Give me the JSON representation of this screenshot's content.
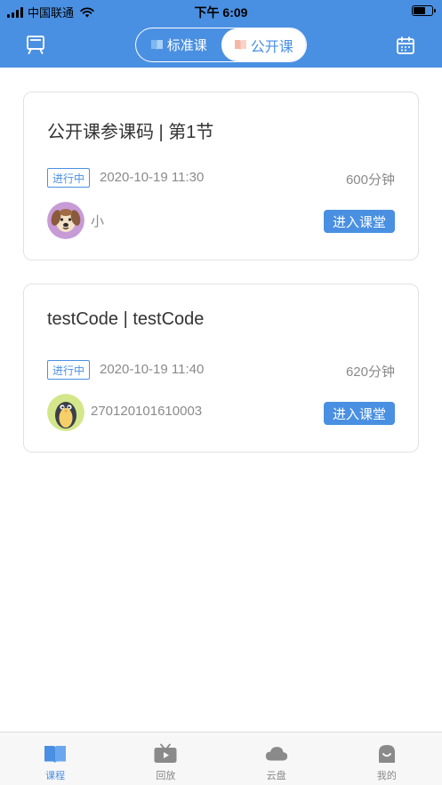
{
  "status_bar": {
    "carrier": "中国联通",
    "time": "下午 6:09"
  },
  "nav": {
    "segments": [
      {
        "label": "标准课",
        "active": false
      },
      {
        "label": "公开课",
        "active": true
      }
    ]
  },
  "courses": [
    {
      "title": "公开课参课码 | 第1节",
      "status": "进行中",
      "datetime": "2020-10-19 11:30",
      "duration": "600分钟",
      "teacher": "小",
      "avatar": "dog-avatar",
      "action": "进入课堂"
    },
    {
      "title": "testCode | testCode",
      "status": "进行中",
      "datetime": "2020-10-19 11:40",
      "duration": "620分钟",
      "teacher": "270120101610003",
      "avatar": "penguin-avatar",
      "action": "进入课堂"
    }
  ],
  "tabbar": {
    "items": [
      {
        "label": "课程",
        "icon": "book-icon",
        "active": true
      },
      {
        "label": "回放",
        "icon": "tv-icon",
        "active": false
      },
      {
        "label": "云盘",
        "icon": "cloud-icon",
        "active": false
      },
      {
        "label": "我的",
        "icon": "profile-icon",
        "active": false
      }
    ]
  },
  "colors": {
    "accent": "#4a90e2",
    "muted_text": "#8a8a8a",
    "inactive_tab": "#888888"
  }
}
